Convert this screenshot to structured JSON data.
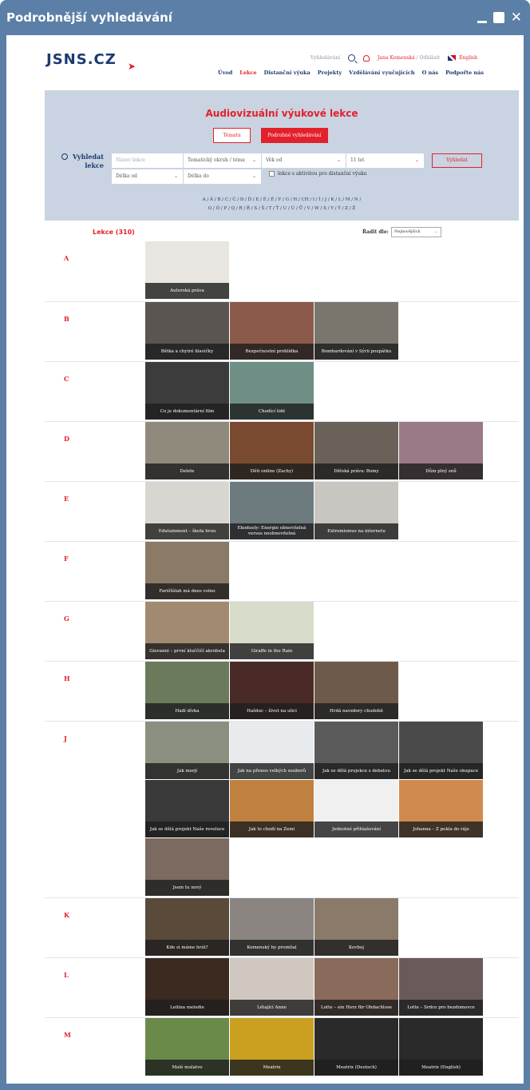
{
  "window": {
    "title": "Podrobnější vyhledávání"
  },
  "header": {
    "logo": "JSNS.CZ",
    "links": {
      "search": "Vyhledávání",
      "user": "Jana Komenská",
      "logout": "/ Odhlásit",
      "language": "English"
    },
    "nav": [
      "Úvod",
      "Lekce",
      "Distanční výuka",
      "Projekty",
      "Vzdělávání vyučujících",
      "O nás",
      "Podpořte nás"
    ],
    "active_nav": "Lekce"
  },
  "search_panel": {
    "title": "Audiovizuální výukové lekce",
    "btn_topics": "Témata",
    "btn_advanced": "Podrobné vyhledávání",
    "label": "Vyhledat lekce",
    "name_placeholder": "Název lekce",
    "topic_field": "Tematický okruh / téma",
    "age_from": "Věk od",
    "years": "11 let",
    "search_button": "Vyhledat",
    "length_from": "Délka od",
    "length_to": "Délka do",
    "distance_checkbox": "lekce s aktivitou pro distanční výuku",
    "alphabet_line1": "A / Á / B / C / Č / D / Ď / E / É / Ě / F / G / H / CH / I / Í / J / K / L / M / N /",
    "alphabet_line2": "O / Ó / P / Q / R / Ř / S / Š / T / Ť / U / Ú / Ů / V / W / X / Y / Ý / Z / Ž"
  },
  "results": {
    "count_label": "Lekce (310)",
    "sort_label": "Řadit dle:",
    "sort_value": "Nejnovějších"
  },
  "groups": [
    {
      "letter": "A",
      "items": [
        {
          "title": "Autorská práva",
          "color": "#e9e6e2"
        }
      ]
    },
    {
      "letter": "B",
      "items": [
        {
          "title": "Bětka a chytré hlavičky",
          "color": "#5a5550"
        },
        {
          "title": "Bezpečnostní prohlídka",
          "color": "#8c5a4a"
        },
        {
          "title": "Bombardování v Sýrii pozpátku",
          "color": "#7a766e"
        }
      ]
    },
    {
      "letter": "C",
      "items": [
        {
          "title": "Co je dokumentární film",
          "color": "#3c3c3c"
        },
        {
          "title": "Chodící lidé",
          "color": "#6f8f86"
        }
      ]
    },
    {
      "letter": "D",
      "items": [
        {
          "title": "Delete",
          "color": "#8f8a7c"
        },
        {
          "title": "Děti online (Zachy)",
          "color": "#7a4a30"
        },
        {
          "title": "Dětská práva: Romy",
          "color": "#6a6258"
        },
        {
          "title": "Dům plný snů",
          "color": "#9a7a86"
        }
      ]
    },
    {
      "letter": "E",
      "items": [
        {
          "title": "Edutainment – škola hrou",
          "color": "#d9d6d2"
        },
        {
          "title": "Ekoduely: Energie obnovitelná versus neobnovitelná",
          "color": "#6d7a7e"
        },
        {
          "title": "Extremismus na internetu",
          "color": "#c9c6c2"
        }
      ]
    },
    {
      "letter": "F",
      "items": [
        {
          "title": "Farišťúlah má dnes volno",
          "color": "#8a7a66"
        }
      ]
    },
    {
      "letter": "G",
      "items": [
        {
          "title": "Giovanni – první kluččičí akrobela",
          "color": "#a28a70"
        },
        {
          "title": "Giraffe in the Rain",
          "color": "#d7dccb"
        }
      ]
    },
    {
      "letter": "H",
      "items": [
        {
          "title": "Hadí dívka",
          "color": "#6a7a5a"
        },
        {
          "title": "Hašduc – život na ulici",
          "color": "#4a2a26"
        },
        {
          "title": "Hrdá navzdory chudobě",
          "color": "#6e5a4a"
        }
      ]
    },
    {
      "letter": "J",
      "items": [
        {
          "title": "Jak merjí",
          "color": "#8a8f80"
        },
        {
          "title": "Jak na přenos velkých souborů",
          "color": "#e8ebee"
        },
        {
          "title": "Jak se dělá projekce s debatou",
          "color": "#5a5a5a"
        },
        {
          "title": "Jak se dělá projekt Naše okupace",
          "color": "#4a4a4a"
        },
        {
          "title": "Jak se dělá projekt Naše revoluce",
          "color": "#3a3a3a"
        },
        {
          "title": "Jak to chodí na Zemi",
          "color": "#c08040"
        },
        {
          "title": "Jednotné přihlašování",
          "color": "#f0f0f0"
        },
        {
          "title": "Johanna – Z pekla do ráje",
          "color": "#d08a50"
        },
        {
          "title": "Jsem tu nový",
          "color": "#7a6a60"
        }
      ]
    },
    {
      "letter": "K",
      "items": [
        {
          "title": "Kde si máme hrát?",
          "color": "#5a4a3a"
        },
        {
          "title": "Komenský by promítal",
          "color": "#8a8580"
        },
        {
          "title": "Kovboj",
          "color": "#8a7a6a"
        }
      ]
    },
    {
      "letter": "L",
      "items": [
        {
          "title": "Leilina melodie",
          "color": "#3a2a20"
        },
        {
          "title": "Létající Anne",
          "color": "#d0c8c0"
        },
        {
          "title": "Lotte – ein Herz für Obdachlose",
          "color": "#8a6a5a"
        },
        {
          "title": "Lotte – Srdce pro bezdomovce",
          "color": "#6a5a5a"
        }
      ]
    },
    {
      "letter": "M",
      "items": [
        {
          "title": "Malé mulatvo",
          "color": "#6a8a4a"
        },
        {
          "title": "Meatrix",
          "color": "#c9a020"
        },
        {
          "title": "Meatrix (Deutsch)",
          "color": "#2a2a2a"
        },
        {
          "title": "Meatrix (English)",
          "color": "#2a2a2a"
        }
      ]
    }
  ]
}
